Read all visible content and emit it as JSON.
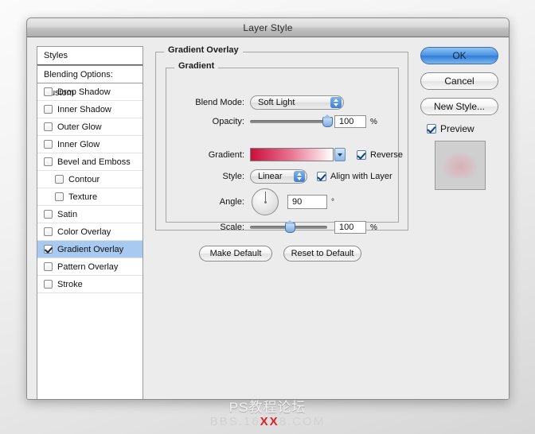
{
  "window": {
    "title": "Layer Style"
  },
  "styles_panel": {
    "header": "Styles",
    "blending_options": "Blending Options: Custom",
    "items": [
      {
        "label": "Drop Shadow",
        "checked": false,
        "indent": false,
        "selected": false
      },
      {
        "label": "Inner Shadow",
        "checked": false,
        "indent": false,
        "selected": false
      },
      {
        "label": "Outer Glow",
        "checked": false,
        "indent": false,
        "selected": false
      },
      {
        "label": "Inner Glow",
        "checked": false,
        "indent": false,
        "selected": false
      },
      {
        "label": "Bevel and Emboss",
        "checked": false,
        "indent": false,
        "selected": false
      },
      {
        "label": "Contour",
        "checked": false,
        "indent": true,
        "selected": false
      },
      {
        "label": "Texture",
        "checked": false,
        "indent": true,
        "selected": false
      },
      {
        "label": "Satin",
        "checked": false,
        "indent": false,
        "selected": false
      },
      {
        "label": "Color Overlay",
        "checked": false,
        "indent": false,
        "selected": false
      },
      {
        "label": "Gradient Overlay",
        "checked": true,
        "indent": false,
        "selected": true
      },
      {
        "label": "Pattern Overlay",
        "checked": false,
        "indent": false,
        "selected": false
      },
      {
        "label": "Stroke",
        "checked": false,
        "indent": false,
        "selected": false
      }
    ]
  },
  "main": {
    "group_title": "Gradient Overlay",
    "sub_group_title": "Gradient",
    "blend_mode": {
      "label": "Blend Mode:",
      "value": "Soft Light"
    },
    "opacity": {
      "label": "Opacity:",
      "value": "100",
      "unit": "%",
      "percent": 100
    },
    "gradient": {
      "label": "Gradient:",
      "start_color": "#c8103c",
      "mid_color": "#e8728f",
      "end_color": "#ffffff",
      "reverse_label": "Reverse",
      "reverse_checked": true
    },
    "style": {
      "label": "Style:",
      "value": "Linear",
      "align_label": "Align with Layer",
      "align_checked": true
    },
    "angle": {
      "label": "Angle:",
      "value": "90",
      "unit": "°"
    },
    "scale": {
      "label": "Scale:",
      "value": "100",
      "unit": "%",
      "percent": 52
    },
    "make_default": "Make Default",
    "reset_to_default": "Reset to Default"
  },
  "right": {
    "ok": "OK",
    "cancel": "Cancel",
    "new_style": "New Style...",
    "preview_label": "Preview",
    "preview_checked": true
  },
  "watermark": {
    "line1": "PS教程论坛",
    "line2_a": "BBS.16",
    "line2_red": "XX",
    "line2_b": "8.COM"
  }
}
